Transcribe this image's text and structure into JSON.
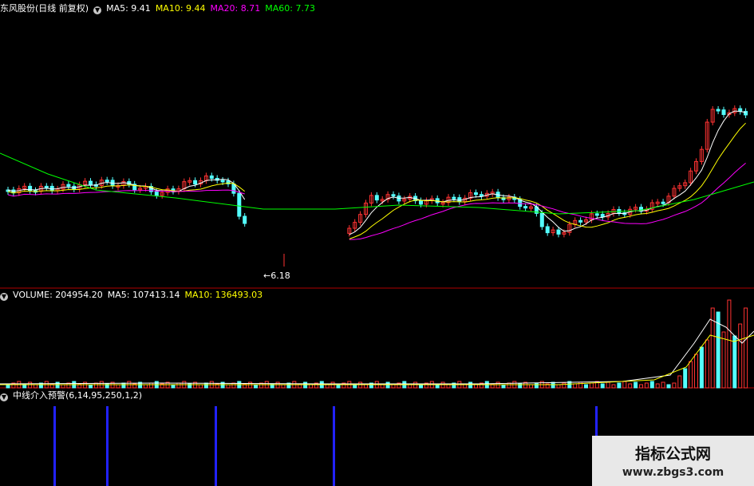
{
  "main_header": {
    "stock_title": "东风股份(日线 前复权)",
    "ma5": "MA5: 9.41",
    "ma10": "MA10: 9.44",
    "ma20": "MA20: 8.71",
    "ma60": "MA60: 7.73"
  },
  "low_price_label": "←6.18",
  "volume_header": {
    "volume": "VOLUME: 204954.20",
    "ma5": "MA5: 107413.14",
    "ma10": "MA10: 136493.03"
  },
  "indicator_header": {
    "name": "中线介入预警(6,14,95,250,1,2)"
  },
  "watermark": {
    "title": "指标公式网",
    "url": "www.zbgs3.com"
  },
  "colors": {
    "up": "#ff3232",
    "down": "#54ffff",
    "ma5": "#ffffff",
    "ma10": "#ffff00",
    "ma20": "#ff00ff",
    "ma60": "#00ff00",
    "signal": "#2222ff",
    "divider": "#b00000"
  },
  "chart_data": {
    "type": "candlestick",
    "panels": [
      "price",
      "volume",
      "indicator"
    ],
    "signal_bars": [
      6,
      17,
      40,
      66,
      120
    ],
    "notes": "Daily candlestick chart with MA5/MA10/MA20/MA60 overlays, volume bars with MA5/MA10, and a buy-signal indicator panel."
  }
}
